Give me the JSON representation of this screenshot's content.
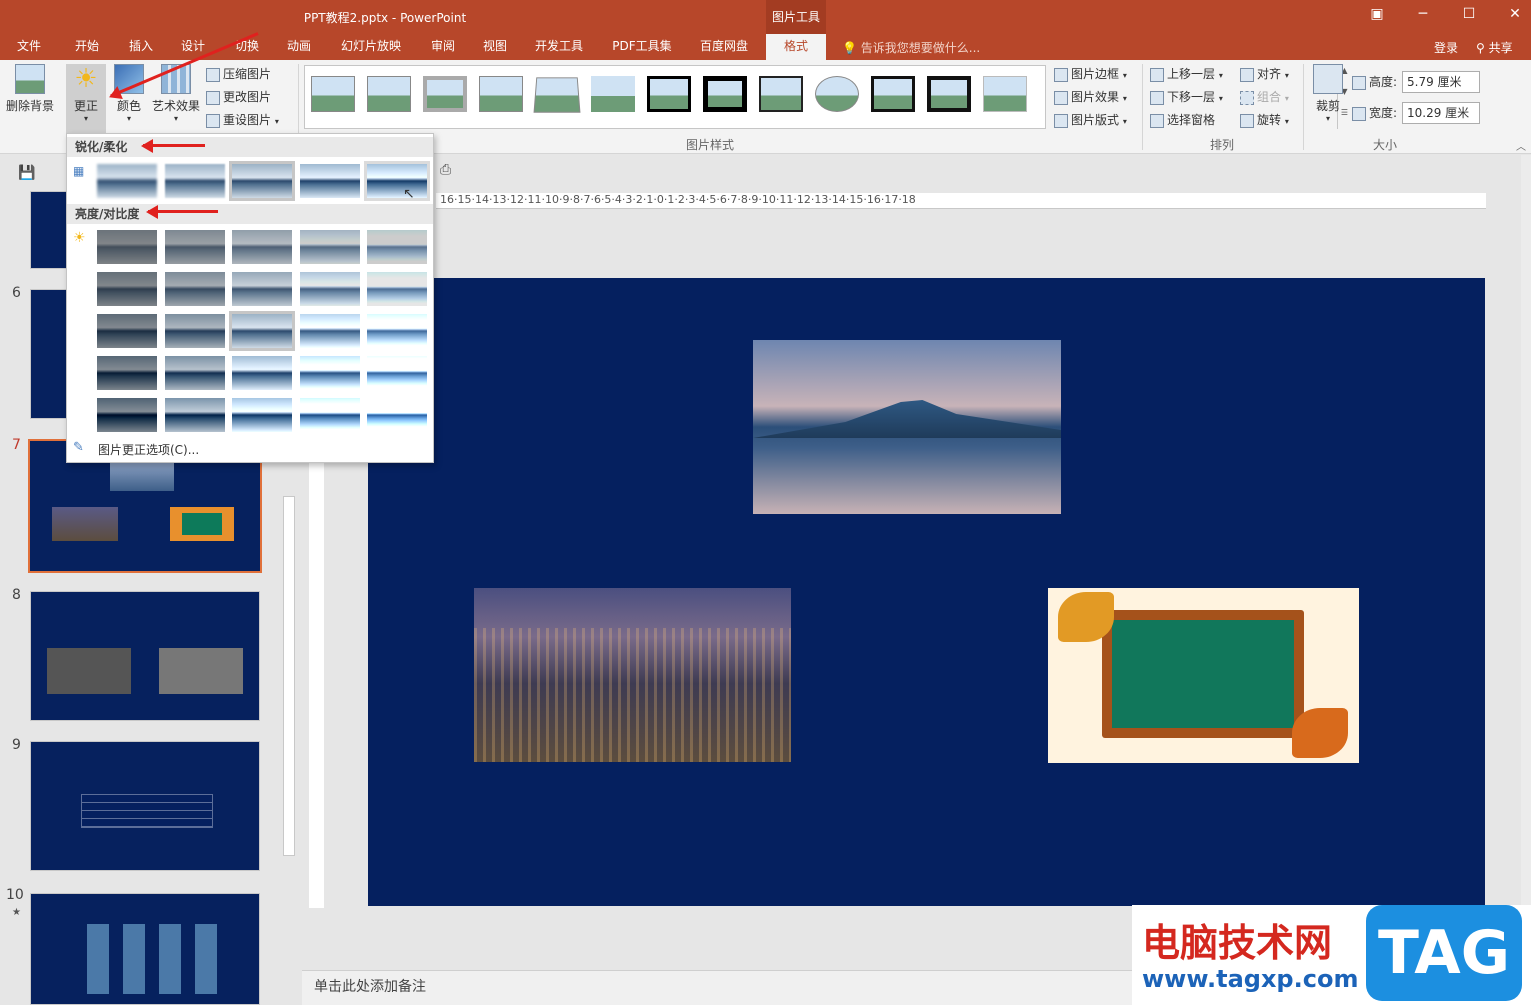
{
  "window": {
    "title": "PPT教程2.pptx - PowerPoint",
    "context_tools": "图片工具"
  },
  "tabs": [
    "文件",
    "开始",
    "插入",
    "设计",
    "切换",
    "动画",
    "幻灯片放映",
    "审阅",
    "视图",
    "开发工具",
    "PDF工具集",
    "百度网盘",
    "格式"
  ],
  "active_tab": "格式",
  "tell_me": "告诉我您想要做什么...",
  "account": {
    "login": "登录",
    "share": "共享"
  },
  "ribbon": {
    "remove_bg": "删除背景",
    "corrections": "更正",
    "color": "颜色",
    "artistic": "艺术效果",
    "compress": "压缩图片",
    "change": "更改图片",
    "reset": "重设图片",
    "styles_label": "图片样式",
    "border": "图片边框",
    "effects": "图片效果",
    "layout": "图片版式",
    "bring_forward": "上移一层",
    "send_backward": "下移一层",
    "selection_pane": "选择窗格",
    "align": "对齐",
    "group": "组合",
    "rotate": "旋转",
    "arrange_label": "排列",
    "crop": "裁剪",
    "height_label": "高度:",
    "height_value": "5.79 厘米",
    "width_label": "宽度:",
    "width_value": "10.29 厘米",
    "size_label": "大小"
  },
  "dropdown": {
    "sharpen_header": "锐化/柔化",
    "brightness_header": "亮度/对比度",
    "options": "图片更正选项(C)..."
  },
  "slides": [
    "6",
    "7",
    "8",
    "9",
    "10"
  ],
  "ruler_top": "16·15·14·13·12·11·10·9·8·7·6·5·4·3·2·1·0·1·2·3·4·5·6·7·8·9·10·11·12·13·14·15·16·17·18",
  "notes": "单击此处添加备注",
  "watermark": {
    "cn": "电脑技术网",
    "url": "www.tagxp.com",
    "tag": "TAG"
  },
  "colors": {
    "accent": "#b7472a",
    "slide_bg": "#05205f",
    "arrow": "#e0211e"
  }
}
